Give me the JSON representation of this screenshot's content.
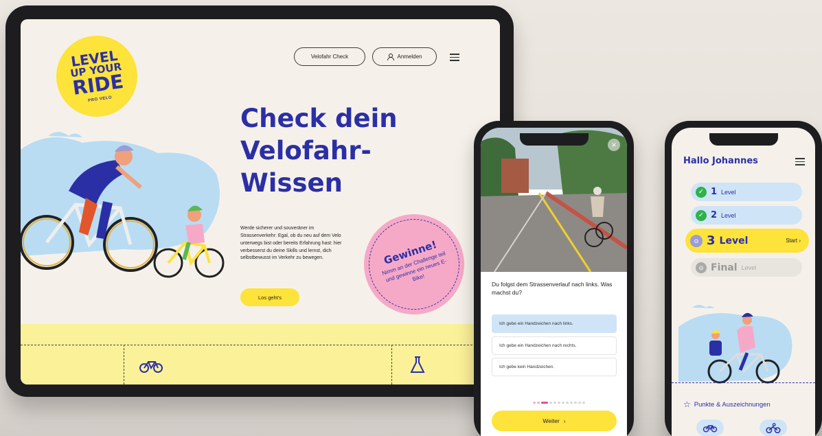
{
  "tablet": {
    "logo": {
      "line1": "LEVEL",
      "line2": "UP YOUR",
      "line3": "RIDE",
      "sub": "PRO VELO"
    },
    "nav": {
      "check_label": "Velofahr Check",
      "login_label": "Anmelden"
    },
    "hero": {
      "title_line1": "Check dein",
      "title_line2": "Velofahr-",
      "title_line3": "Wissen",
      "text": "Werde sicherer und souveräner im Strassenverkehr: Egal, ob du neu auf dem Velo unterwegs bist oder bereits Erfahrung hast: hier verbesserst du deine Skills und lernst, dich selbstbewusst im Verkehr zu bewegen.",
      "cta_label": "Los geht's"
    },
    "badge": {
      "title": "Gewinne!",
      "text": "Nimm an der Challenge teil und gewinne ein neues E-Bike!"
    },
    "colors": {
      "brand_blue": "#2b2fa6",
      "yellow": "#fde33a",
      "pink": "#f6a9c7",
      "light_blue": "#cfe4f7"
    }
  },
  "quiz_phone": {
    "question": "Du folgst dem Strassenverlauf nach links. Was machst du?",
    "answers": [
      {
        "label": "Ich gebe ein Handzeichen nach links.",
        "selected": true
      },
      {
        "label": "Ich gebe ein Handzeichen nach rechts.",
        "selected": false
      },
      {
        "label": "Ich gebe kein Handzeichen.",
        "selected": false
      }
    ],
    "progress": {
      "current_step": 3,
      "total_steps": 12
    },
    "next_label": "Weiter"
  },
  "levels_phone": {
    "greeting": "Hallo Johannes",
    "levels": [
      {
        "number": "1",
        "word": "Level",
        "status": "done"
      },
      {
        "number": "2",
        "word": "Level",
        "status": "done"
      },
      {
        "number": "3",
        "word": "Level",
        "status": "current",
        "action": "Start"
      },
      {
        "number": "Final",
        "word": "Level",
        "status": "locked"
      }
    ],
    "points_label": "Punkte & Auszeichnungen"
  }
}
